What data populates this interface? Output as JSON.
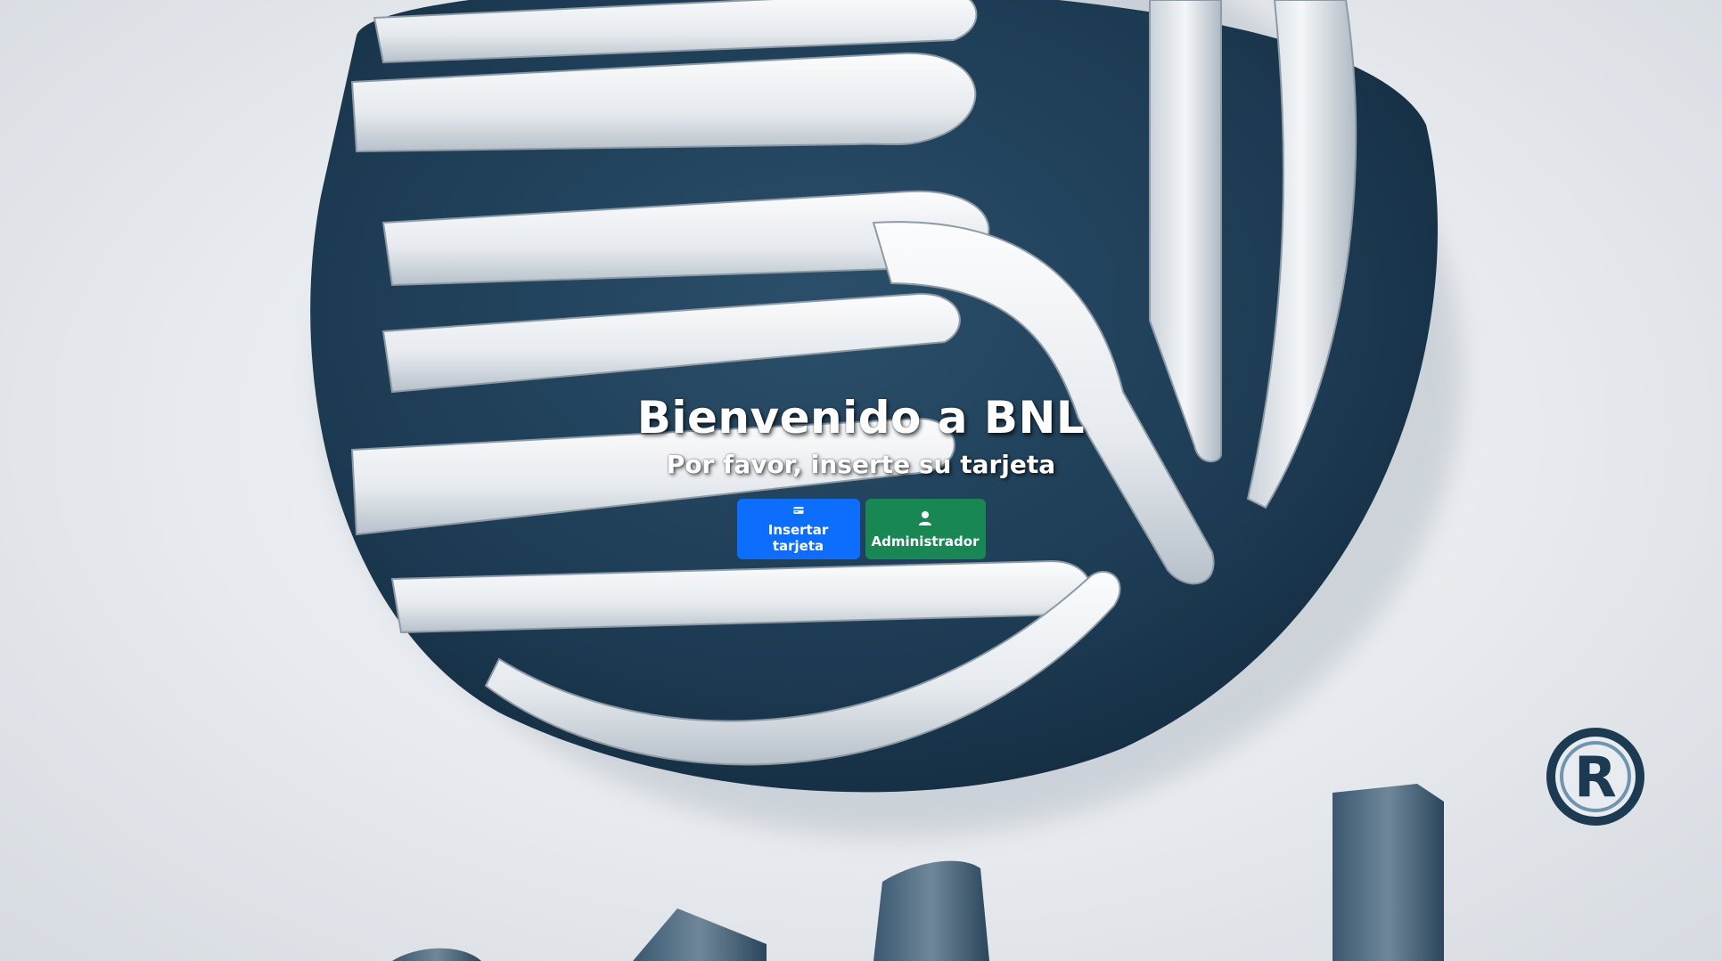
{
  "page": {
    "title": "Bienvenido a BNL",
    "subtitle": "Por favor, inserte su tarjeta"
  },
  "actions": {
    "insert_card_label": "Insertar tarjeta",
    "insert_card_icon": "credit-card-icon",
    "admin_label": "Administrador",
    "admin_icon": "person-icon"
  },
  "background": {
    "logo_text": "BNL",
    "registered_mark": "R"
  },
  "colors": {
    "primary": "#0d6efd",
    "success": "#198754",
    "logo_dark": "#1f4058",
    "logo_silver": "#e9edf1"
  }
}
